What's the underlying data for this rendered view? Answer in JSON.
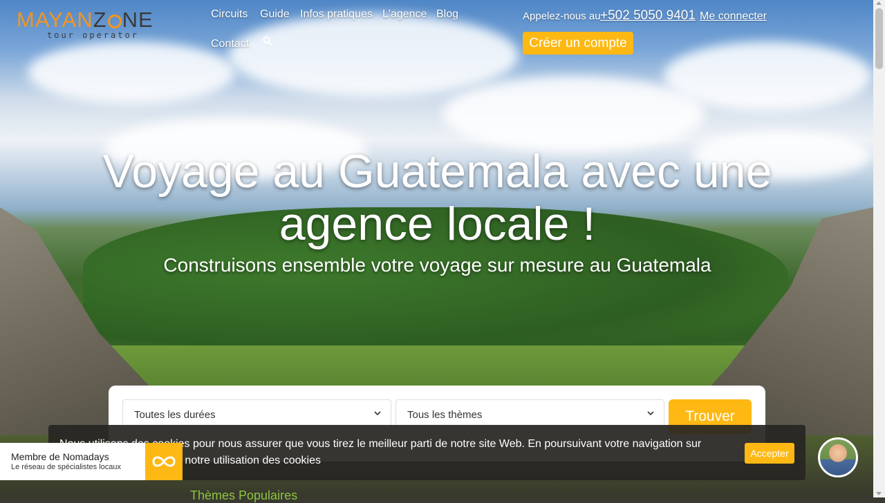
{
  "brand": {
    "logo_name_parts": [
      "MAYAN",
      "Z",
      "NE"
    ],
    "tagline": "tour operator",
    "colors": {
      "accent": "#fdb813",
      "logo_orange": "#f7941d",
      "teaser_green": "#8cc63f"
    }
  },
  "nav": {
    "items": [
      {
        "label": "Circuits"
      },
      {
        "label": "Guide"
      },
      {
        "label": "Infos pratiques"
      },
      {
        "label": "L'agence"
      },
      {
        "label": "Blog"
      },
      {
        "label": "Contact"
      }
    ],
    "search_icon": "search-icon"
  },
  "header": {
    "call_label": "Appelez-nous au",
    "phone": "+502 5050 9401",
    "login_label": "Me connecter",
    "create_account_label": "Créer un compte"
  },
  "hero": {
    "title": "Voyage au Guatemala avec une agence locale !",
    "subtitle": "Construisons ensemble votre voyage sur mesure au Guatemala"
  },
  "search": {
    "duration_value": "Toutes les durées",
    "theme_value": "Tous les thèmes",
    "submit_label": "Trouver"
  },
  "cookie": {
    "message": "Nous utilisons des cookies pour nous assurer que vous tirez le meilleur parti de notre site Web. En poursuivant votre navigation sur notre site, vous acceptez notre utilisation des cookies",
    "accept_label": "Accepter"
  },
  "nomadays": {
    "title": "Membre de Nomadays",
    "subtitle": "Le réseau de spécialistes locaux"
  },
  "teaser": {
    "text": "Thèmes Populaires"
  }
}
